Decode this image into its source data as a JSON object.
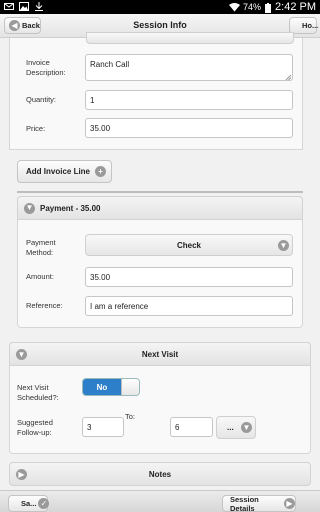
{
  "status_bar": {
    "battery": "74%",
    "time": "2:42 PM"
  },
  "header": {
    "title": "Session Info",
    "back_label": "Back",
    "home_label": "Ho..."
  },
  "invoice": {
    "description_label": "Invoice Description:",
    "description_value": "Ranch Call",
    "quantity_label": "Quantity:",
    "quantity_value": "1",
    "price_label": "Price:",
    "price_value": "35.00"
  },
  "add_invoice_line_label": "Add Invoice Line",
  "payment": {
    "header": "Payment - 35.00",
    "method_label": "Payment Method:",
    "method_value": "Check",
    "amount_label": "Amount:",
    "amount_value": "35.00",
    "reference_label": "Reference:",
    "reference_value": "I am a reference"
  },
  "next_visit": {
    "header": "Next Visit",
    "scheduled_label": "Next Visit Scheduled?:",
    "toggle_value": "No",
    "followup_label": "Suggested Follow-up:",
    "from_value": "3",
    "to_label": "To:",
    "to_value": "6",
    "unit_value": "..."
  },
  "notes": {
    "header": "Notes"
  },
  "footer": {
    "left_label": "Sa...",
    "right_label": "Session Details"
  }
}
